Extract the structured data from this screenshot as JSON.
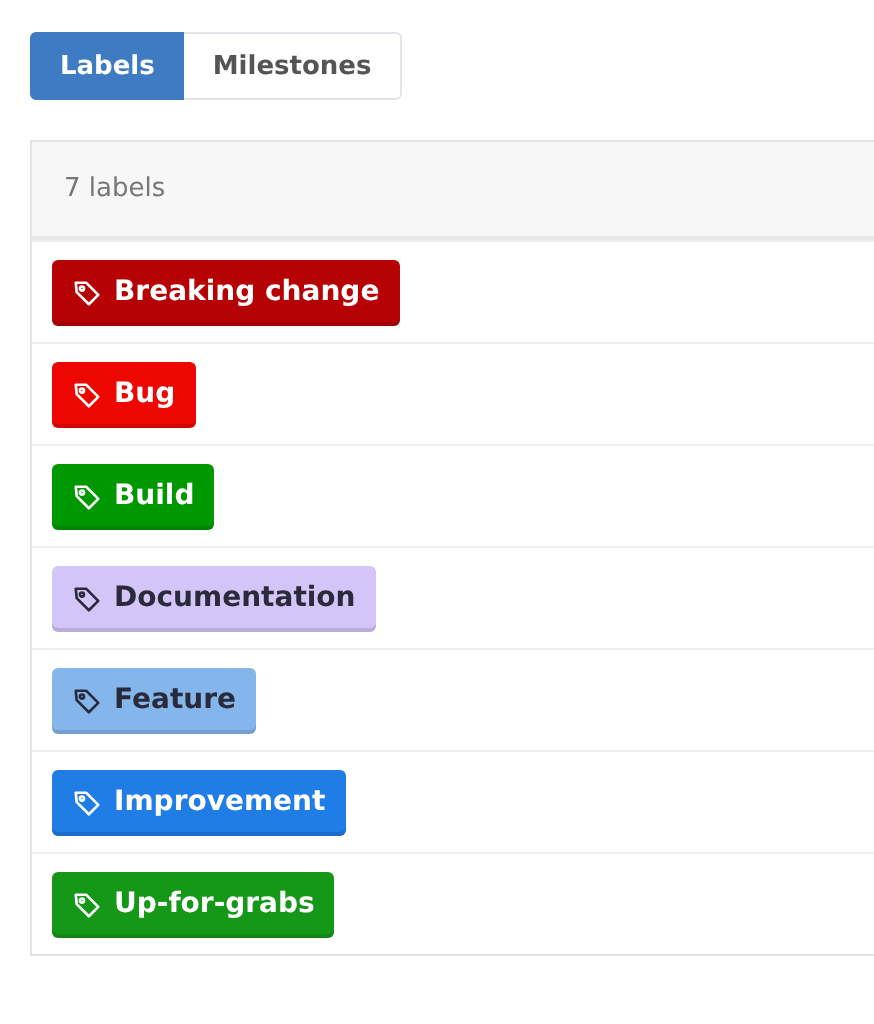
{
  "tabs": [
    {
      "label": "Labels",
      "selected": true
    },
    {
      "label": "Milestones",
      "selected": false
    }
  ],
  "panel": {
    "count": "7 labels"
  },
  "labels": [
    {
      "name": "Breaking change",
      "color": "#b60205"
    },
    {
      "name": "Bug",
      "color": "#ee0701"
    },
    {
      "name": "Build",
      "color": "#009800"
    },
    {
      "name": "Documentation",
      "color": "#d4c5f9"
    },
    {
      "name": "Feature",
      "color": "#84b6eb"
    },
    {
      "name": "Improvement",
      "color": "#207de5"
    },
    {
      "name": "Up-for-grabs",
      "color": "#159818"
    }
  ]
}
